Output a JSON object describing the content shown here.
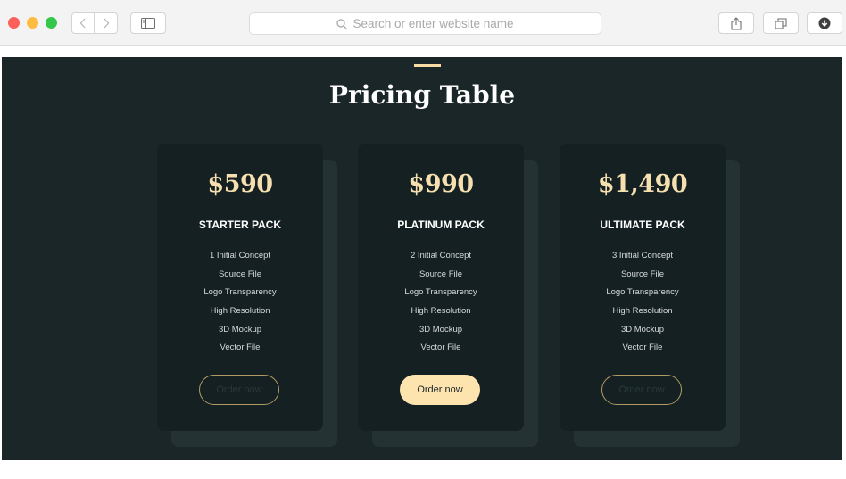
{
  "browser": {
    "address_placeholder": "Search or enter website name"
  },
  "section": {
    "title": "Pricing Table"
  },
  "plans": [
    {
      "price": "$590",
      "name": "STARTER PACK",
      "features": [
        "1 Initial Concept",
        "Source File",
        "Logo Transparency",
        "High Resolution",
        "3D Mockup",
        "Vector File"
      ],
      "button_label": "Order now",
      "button_style": "outline"
    },
    {
      "price": "$990",
      "name": "PLATINUM PACK",
      "features": [
        "2 Initial Concept",
        "Source File",
        "Logo Transparency",
        "High Resolution",
        "3D Mockup",
        "Vector File"
      ],
      "button_label": "Order now",
      "button_style": "filled"
    },
    {
      "price": "$1,490",
      "name": "ULTIMATE PACK",
      "features": [
        "3 Initial Concept",
        "Source File",
        "Logo Transparency",
        "High Resolution",
        "3D Mockup",
        "Vector File"
      ],
      "button_label": "Order now",
      "button_style": "outline"
    }
  ],
  "colors": {
    "section_bg": "#1a2628",
    "card_bg": "#142022",
    "accent": "#fde3ae",
    "price": "#f7e0b0"
  },
  "icons": {
    "back": "chevron-left-icon",
    "forward": "chevron-right-icon",
    "sidebar": "sidebar-icon",
    "search": "search-icon",
    "share": "share-icon",
    "tabs": "tabs-icon",
    "download": "download-icon"
  }
}
